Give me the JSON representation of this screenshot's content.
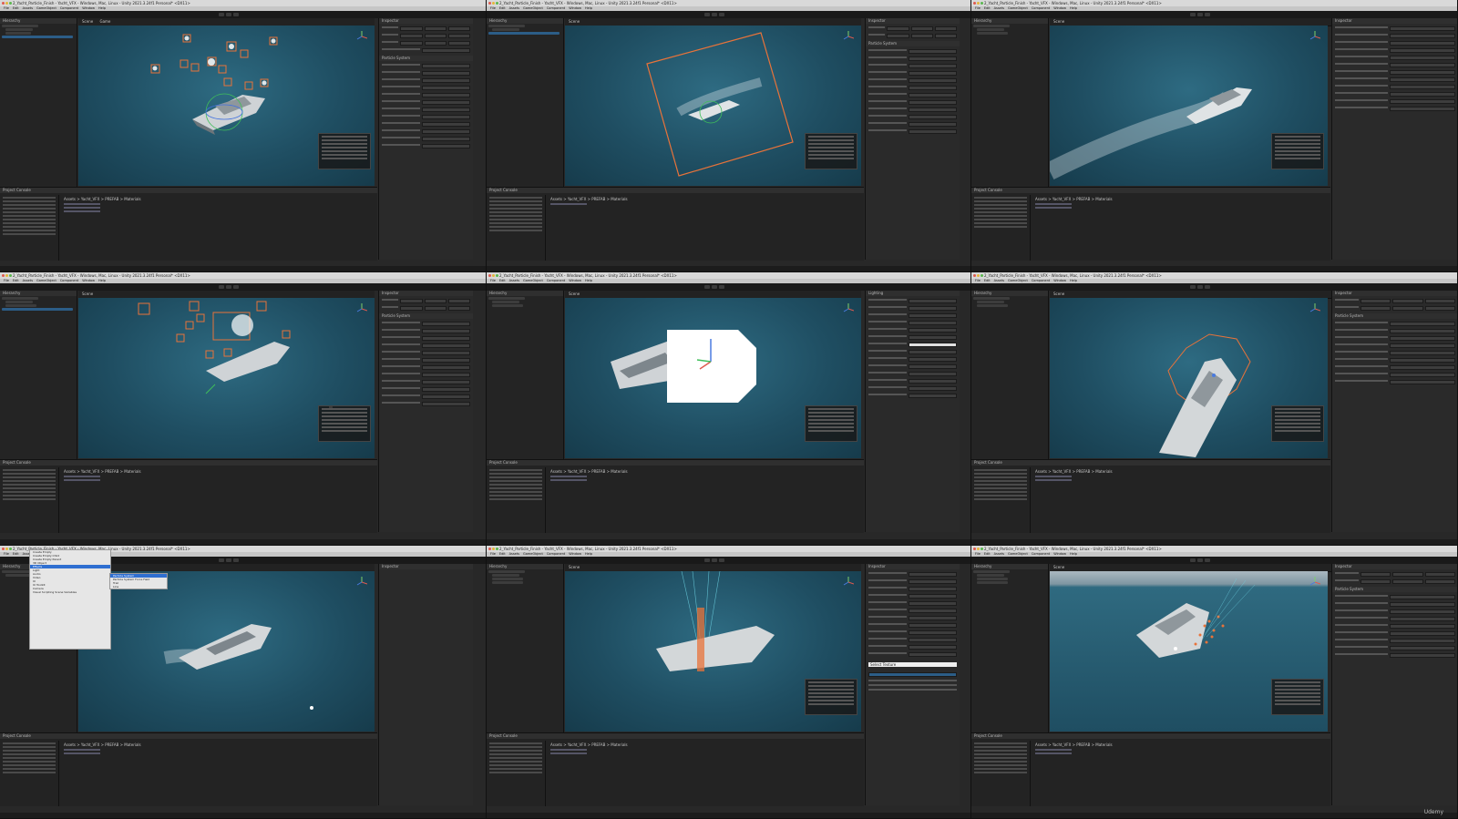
{
  "window": {
    "title": "2_Yacht_Particle_Finish - Yacht_VFX - Windows, Mac, Linux - Unity 2021.3.24f1 Personal* <DX11>",
    "menu": [
      "File",
      "Edit",
      "Assets",
      "GameObject",
      "Component",
      "Window",
      "Help"
    ]
  },
  "panels": {
    "hierarchy": "Hierarchy",
    "scene": "Scene",
    "game": "Game",
    "inspector": "Inspector",
    "lighting": "Lighting",
    "project": "Project",
    "console": "Console",
    "particle_system": "Particle System"
  },
  "project_path": "Assets > Yacht_VFX > PREFAB > Materials",
  "context_menu": {
    "items": [
      "Create Empty",
      "Create Empty Child",
      "Create Empty Parent",
      "3D Object",
      "Effects",
      "Light",
      "Audio",
      "Video",
      "UI",
      "UI Toolkit",
      "Camera",
      "Visual Scripting Scene Variables"
    ],
    "submenu": [
      "Particle System",
      "Particle System Force Field",
      "Trail",
      "Line"
    ]
  },
  "dropdown": {
    "selected": "Select Texture"
  },
  "watermark": "Udemy",
  "colors": {
    "water": "#1f4e62",
    "selection": "#2c5d87",
    "highlight_orange": "#e8733a"
  }
}
